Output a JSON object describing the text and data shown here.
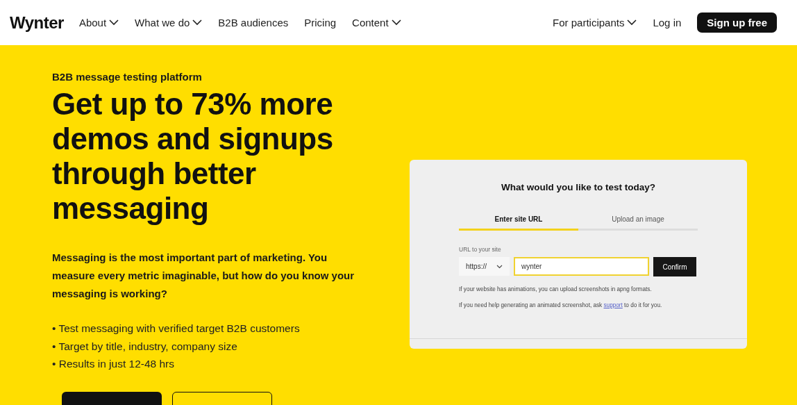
{
  "nav": {
    "logo": "Wynter",
    "items": [
      {
        "label": "About",
        "dropdown": true
      },
      {
        "label": "What we do",
        "dropdown": true
      },
      {
        "label": "B2B audiences",
        "dropdown": false
      },
      {
        "label": "Pricing",
        "dropdown": false
      },
      {
        "label": "Content",
        "dropdown": true
      }
    ],
    "right_items": [
      {
        "label": "For participants",
        "dropdown": true
      },
      {
        "label": "Log in",
        "dropdown": false
      }
    ],
    "cta": "Sign up free"
  },
  "hero": {
    "eyebrow": "B2B message testing platform",
    "headline": "Get up to 73% more demos and signups through better messaging",
    "lead": "Messaging is the most important part of marketing. You measure every metric imaginable, but how do you know your messaging is working?",
    "bullets": [
      "• Test messaging with verified target B2B customers",
      "• Target by title, industry, company size",
      "• Results in just 12-48 hrs"
    ],
    "buttons": [
      {
        "kind": "primary"
      },
      {
        "kind": "outline"
      }
    ]
  },
  "card": {
    "title": "What would you like to test today?",
    "tabs": [
      {
        "label": "Enter site URL",
        "selected": true
      },
      {
        "label": "Upload an image",
        "selected": false
      }
    ],
    "field_label": "URL to your site",
    "protocol": "https://",
    "url_value": "wynter",
    "confirm": "Confirm",
    "note": "If your website has animations, you can upload screenshots in apng formats.",
    "help_before": "If you need help generating an animated screenshot, ask",
    "help_link": "support",
    "help_after": "to do it for you."
  }
}
